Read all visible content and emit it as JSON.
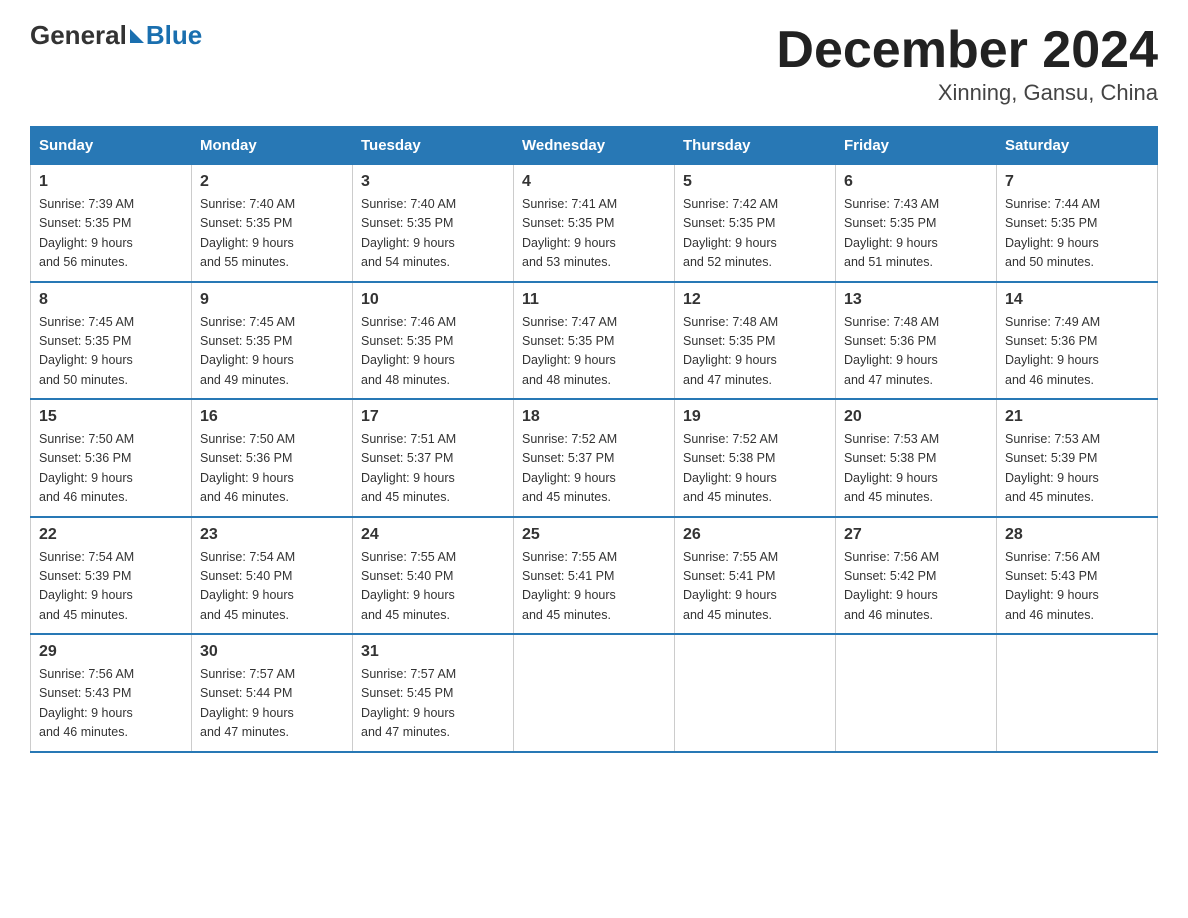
{
  "header": {
    "logo_text": "General",
    "logo_blue": "Blue",
    "title": "December 2024",
    "subtitle": "Xinning, Gansu, China"
  },
  "days_of_week": [
    "Sunday",
    "Monday",
    "Tuesday",
    "Wednesday",
    "Thursday",
    "Friday",
    "Saturday"
  ],
  "weeks": [
    [
      {
        "day": "1",
        "sunrise": "7:39 AM",
        "sunset": "5:35 PM",
        "daylight": "9 hours and 56 minutes."
      },
      {
        "day": "2",
        "sunrise": "7:40 AM",
        "sunset": "5:35 PM",
        "daylight": "9 hours and 55 minutes."
      },
      {
        "day": "3",
        "sunrise": "7:40 AM",
        "sunset": "5:35 PM",
        "daylight": "9 hours and 54 minutes."
      },
      {
        "day": "4",
        "sunrise": "7:41 AM",
        "sunset": "5:35 PM",
        "daylight": "9 hours and 53 minutes."
      },
      {
        "day": "5",
        "sunrise": "7:42 AM",
        "sunset": "5:35 PM",
        "daylight": "9 hours and 52 minutes."
      },
      {
        "day": "6",
        "sunrise": "7:43 AM",
        "sunset": "5:35 PM",
        "daylight": "9 hours and 51 minutes."
      },
      {
        "day": "7",
        "sunrise": "7:44 AM",
        "sunset": "5:35 PM",
        "daylight": "9 hours and 50 minutes."
      }
    ],
    [
      {
        "day": "8",
        "sunrise": "7:45 AM",
        "sunset": "5:35 PM",
        "daylight": "9 hours and 50 minutes."
      },
      {
        "day": "9",
        "sunrise": "7:45 AM",
        "sunset": "5:35 PM",
        "daylight": "9 hours and 49 minutes."
      },
      {
        "day": "10",
        "sunrise": "7:46 AM",
        "sunset": "5:35 PM",
        "daylight": "9 hours and 48 minutes."
      },
      {
        "day": "11",
        "sunrise": "7:47 AM",
        "sunset": "5:35 PM",
        "daylight": "9 hours and 48 minutes."
      },
      {
        "day": "12",
        "sunrise": "7:48 AM",
        "sunset": "5:35 PM",
        "daylight": "9 hours and 47 minutes."
      },
      {
        "day": "13",
        "sunrise": "7:48 AM",
        "sunset": "5:36 PM",
        "daylight": "9 hours and 47 minutes."
      },
      {
        "day": "14",
        "sunrise": "7:49 AM",
        "sunset": "5:36 PM",
        "daylight": "9 hours and 46 minutes."
      }
    ],
    [
      {
        "day": "15",
        "sunrise": "7:50 AM",
        "sunset": "5:36 PM",
        "daylight": "9 hours and 46 minutes."
      },
      {
        "day": "16",
        "sunrise": "7:50 AM",
        "sunset": "5:36 PM",
        "daylight": "9 hours and 46 minutes."
      },
      {
        "day": "17",
        "sunrise": "7:51 AM",
        "sunset": "5:37 PM",
        "daylight": "9 hours and 45 minutes."
      },
      {
        "day": "18",
        "sunrise": "7:52 AM",
        "sunset": "5:37 PM",
        "daylight": "9 hours and 45 minutes."
      },
      {
        "day": "19",
        "sunrise": "7:52 AM",
        "sunset": "5:38 PM",
        "daylight": "9 hours and 45 minutes."
      },
      {
        "day": "20",
        "sunrise": "7:53 AM",
        "sunset": "5:38 PM",
        "daylight": "9 hours and 45 minutes."
      },
      {
        "day": "21",
        "sunrise": "7:53 AM",
        "sunset": "5:39 PM",
        "daylight": "9 hours and 45 minutes."
      }
    ],
    [
      {
        "day": "22",
        "sunrise": "7:54 AM",
        "sunset": "5:39 PM",
        "daylight": "9 hours and 45 minutes."
      },
      {
        "day": "23",
        "sunrise": "7:54 AM",
        "sunset": "5:40 PM",
        "daylight": "9 hours and 45 minutes."
      },
      {
        "day": "24",
        "sunrise": "7:55 AM",
        "sunset": "5:40 PM",
        "daylight": "9 hours and 45 minutes."
      },
      {
        "day": "25",
        "sunrise": "7:55 AM",
        "sunset": "5:41 PM",
        "daylight": "9 hours and 45 minutes."
      },
      {
        "day": "26",
        "sunrise": "7:55 AM",
        "sunset": "5:41 PM",
        "daylight": "9 hours and 45 minutes."
      },
      {
        "day": "27",
        "sunrise": "7:56 AM",
        "sunset": "5:42 PM",
        "daylight": "9 hours and 46 minutes."
      },
      {
        "day": "28",
        "sunrise": "7:56 AM",
        "sunset": "5:43 PM",
        "daylight": "9 hours and 46 minutes."
      }
    ],
    [
      {
        "day": "29",
        "sunrise": "7:56 AM",
        "sunset": "5:43 PM",
        "daylight": "9 hours and 46 minutes."
      },
      {
        "day": "30",
        "sunrise": "7:57 AM",
        "sunset": "5:44 PM",
        "daylight": "9 hours and 47 minutes."
      },
      {
        "day": "31",
        "sunrise": "7:57 AM",
        "sunset": "5:45 PM",
        "daylight": "9 hours and 47 minutes."
      },
      null,
      null,
      null,
      null
    ]
  ]
}
